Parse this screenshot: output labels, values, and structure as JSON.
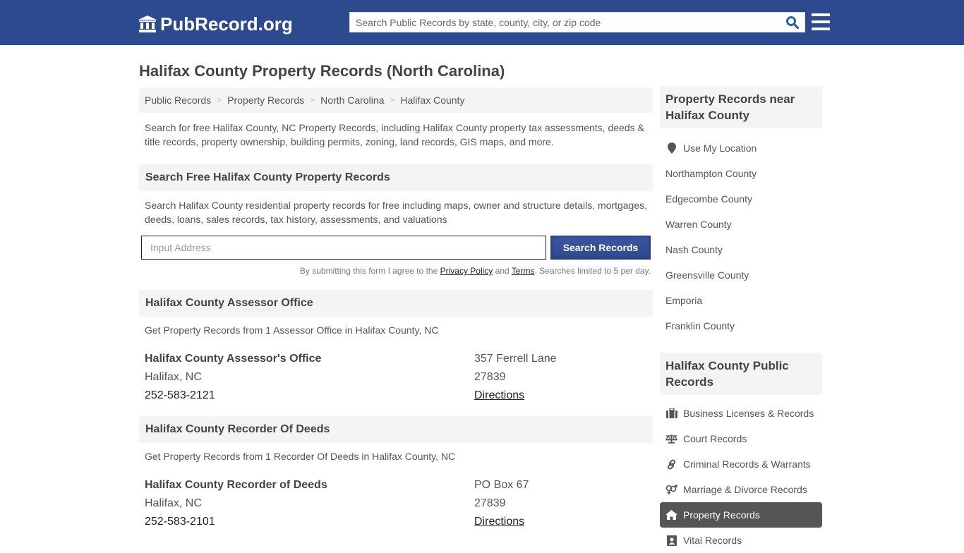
{
  "header": {
    "logo_text": "PubRecord.org",
    "search_placeholder": "Search Public Records by state, county, city, or zip code",
    "search_value": ""
  },
  "page_title": "Halifax County Property Records (North Carolina)",
  "breadcrumb": [
    "Public Records",
    "Property Records",
    "North Carolina",
    "Halifax County"
  ],
  "breadcrumb_separator": ">",
  "intro": "Search for free Halifax County, NC Property Records, including Halifax County property tax assessments, deeds & title records, property ownership, building permits, zoning, land records, GIS maps, and more.",
  "search_section": {
    "title": "Search Free Halifax County Property Records",
    "description": "Search Halifax County residential property records for free including maps, owner and structure details, mortgages, deeds, loans, sales records, tax history, assessments, and valuations",
    "address_placeholder": "Input Address",
    "address_value": "",
    "button_label": "Search Records",
    "disclaimer_prefix": "By submitting this form I agree to the ",
    "privacy_label": "Privacy Policy",
    "disclaimer_and": " and ",
    "terms_label": "Terms",
    "disclaimer_suffix": ". Searches limited to 5 per day."
  },
  "offices": [
    {
      "section_title": "Halifax County Assessor Office",
      "section_desc": "Get Property Records from 1 Assessor Office in Halifax County, NC",
      "name": "Halifax County Assessor's Office",
      "city": "Halifax, NC",
      "phone": "252-583-2121",
      "address": "357 Ferrell Lane",
      "zip": "27839",
      "directions_label": "Directions"
    },
    {
      "section_title": "Halifax County Recorder Of Deeds",
      "section_desc": "Get Property Records from 1 Recorder Of Deeds in Halifax County, NC",
      "name": "Halifax County Recorder of Deeds",
      "city": "Halifax, NC",
      "phone": "252-583-2101",
      "address": "PO Box 67",
      "zip": "27839",
      "directions_label": "Directions"
    }
  ],
  "sidebar": {
    "nearby_title": "Property Records near Halifax County",
    "use_location_label": "Use My Location",
    "nearby": [
      "Northampton County",
      "Edgecombe County",
      "Warren County",
      "Nash County",
      "Greensville County",
      "Emporia",
      "Franklin County"
    ],
    "public_title": "Halifax County Public Records",
    "public_records": [
      {
        "label": "Business Licenses & Records",
        "icon": "briefcase-icon",
        "active": false
      },
      {
        "label": "Court Records",
        "icon": "balance-scale-icon",
        "active": false
      },
      {
        "label": "Criminal Records & Warrants",
        "icon": "link-icon",
        "active": false
      },
      {
        "label": "Marriage & Divorce Records",
        "icon": "venus-mars-icon",
        "active": false
      },
      {
        "label": "Property Records",
        "icon": "home-icon",
        "active": true
      },
      {
        "label": "Vital Records",
        "icon": "id-card-icon",
        "active": false
      }
    ]
  },
  "colors": {
    "brand": "#2e4a8f",
    "panel_bg": "#f4f4f4",
    "active_item_bg": "#555555"
  }
}
